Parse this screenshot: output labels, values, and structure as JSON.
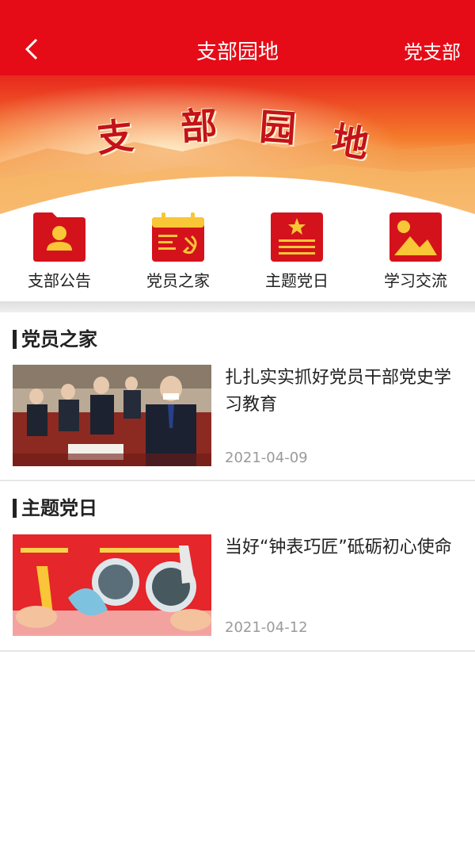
{
  "header": {
    "title": "支部园地",
    "right_action": "党支部",
    "bar_color": "#e50c18"
  },
  "banner": {
    "chars": [
      "支",
      "部",
      "园",
      "地"
    ]
  },
  "shortcuts": [
    {
      "label": "支部公告",
      "icon": "announcement-folder-icon"
    },
    {
      "label": "党员之家",
      "icon": "party-calendar-icon"
    },
    {
      "label": "主题党日",
      "icon": "theme-day-icon"
    },
    {
      "label": "学习交流",
      "icon": "study-image-icon"
    }
  ],
  "sections": [
    {
      "title": "党员之家",
      "items": [
        {
          "title": "扎扎实实抓好党员干部党史学习教育",
          "date": "2021-04-09"
        }
      ]
    },
    {
      "title": "主题党日",
      "items": [
        {
          "title": "当好“钟表巧匠”砥砺初心使命",
          "date": "2021-04-12"
        }
      ]
    }
  ]
}
